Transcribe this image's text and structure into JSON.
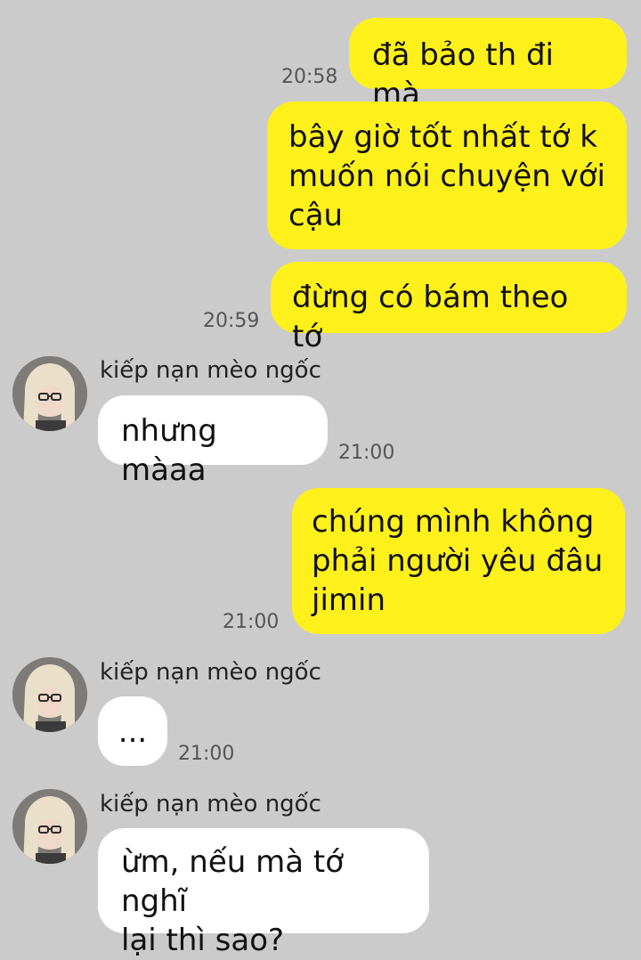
{
  "colors": {
    "background": "#cbcbcb",
    "my_bubble": "#fef01b",
    "their_bubble": "#ffffff"
  },
  "messages": [
    {
      "from": "me",
      "text": "đã bảo th đi mà",
      "time": "20:58"
    },
    {
      "from": "me",
      "text": "bây giờ tốt nhất tớ k\nmuốn nói chuyện với\ncậu",
      "time": ""
    },
    {
      "from": "me",
      "text": "đừng có bám theo tớ",
      "time": "20:59"
    },
    {
      "from": "them",
      "sender": "kiếp nạn mèo ngốc",
      "text": "nhưng màaa",
      "time": "21:00"
    },
    {
      "from": "me",
      "text": "chúng mình không\nphải người yêu đâu\njimin",
      "time": "21:00"
    },
    {
      "from": "them",
      "sender": "kiếp nạn mèo ngốc",
      "text": "...",
      "time": "21:00"
    },
    {
      "from": "them",
      "sender": "kiếp nạn mèo ngốc",
      "text": "ừm, nếu mà tớ nghĩ\nlại thì sao?",
      "time": ""
    }
  ],
  "avatar_icon": "contact-avatar-photo"
}
